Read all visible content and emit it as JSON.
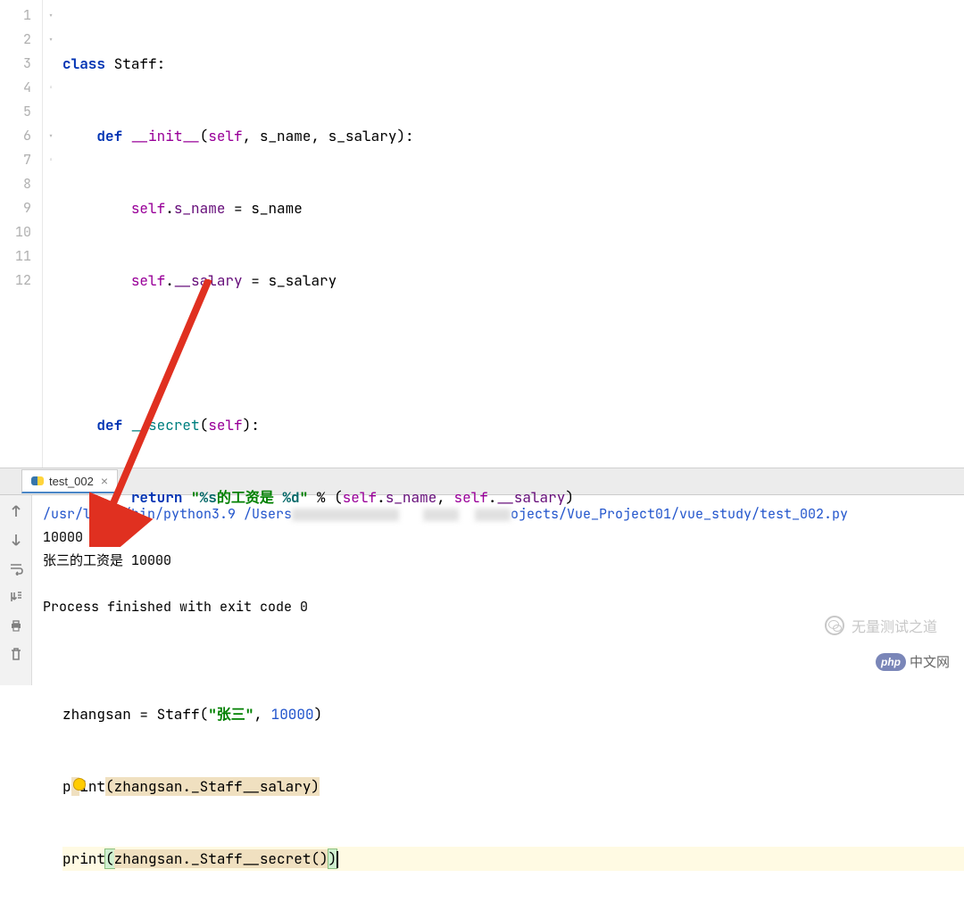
{
  "editor": {
    "lines": [
      "1",
      "2",
      "3",
      "4",
      "5",
      "6",
      "7",
      "8",
      "9",
      "10",
      "11",
      "12"
    ],
    "code": {
      "l1_kw": "class",
      "l1_cls": "Staff",
      "l2_kw": "def",
      "l2_fn": "__init__",
      "l2_args": "(self, s_name, s_salary):",
      "l3": "self.s_name = s_name",
      "l4": "self.__salary = s_salary",
      "l6_kw": "def",
      "l6_fn": "__secret",
      "l6_args": "(self):",
      "l7_kw": "return",
      "l7_str": "\"%s的工资是 %d\"",
      "l7_rest": " % (self.s_name, self.__salary)",
      "l10_a": "zhangsan = Staff(",
      "l10_str": "\"张三\"",
      "l10_b": ", ",
      "l10_num": "10000",
      "l10_c": ")",
      "l11_a": "print(zhangsan._Staff__salary)",
      "l12_a": "print(zhangsan._Staff__secret())"
    }
  },
  "tab": {
    "name": "test_002",
    "close": "×"
  },
  "console": {
    "path_a": "/usr/local/bin/python3.9 /Users",
    "path_b": "ojects/Vue_Project01/vue_study/test_002.py",
    "out1": "10000",
    "out2": "张三的工资是 10000",
    "out3": "Process finished with exit code 0"
  },
  "watermark": {
    "top": "无量测试之道",
    "bottom_badge": "php",
    "bottom_text": "中文网"
  }
}
